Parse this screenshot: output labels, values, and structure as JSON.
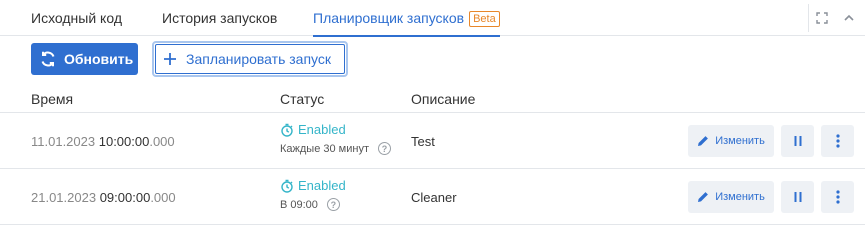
{
  "tabs": [
    {
      "label": "Исходный код"
    },
    {
      "label": "История запусков"
    },
    {
      "label": "Планировщик запусков",
      "badge": "Beta",
      "active": true
    }
  ],
  "toolbar": {
    "refresh_label": "Обновить",
    "schedule_label": "Запланировать запуск"
  },
  "table": {
    "columns": [
      "Время",
      "Статус",
      "Описание"
    ],
    "rows": [
      {
        "date": "11.01.2023",
        "time": "10:00:00",
        "ms": ".000",
        "status": "Enabled",
        "schedule": "Каждые 30 минут",
        "description": "Test",
        "edit_label": "Изменить"
      },
      {
        "date": "21.01.2023",
        "time": "09:00:00",
        "ms": ".000",
        "status": "Enabled",
        "schedule": "В 09:00",
        "description": "Cleaner",
        "edit_label": "Изменить"
      }
    ]
  },
  "colors": {
    "primary": "#2f6fd0",
    "status_enabled": "#35b5c9",
    "beta": "#e8872a"
  },
  "icons": {
    "refresh": "refresh-icon",
    "add": "plus-icon",
    "status": "timer-icon",
    "help": "help-circle-icon",
    "edit": "pencil-icon",
    "pause": "pause-icon",
    "more": "more-vertical-icon",
    "expand": "expand-icon",
    "collapse": "chevron-up-icon"
  }
}
